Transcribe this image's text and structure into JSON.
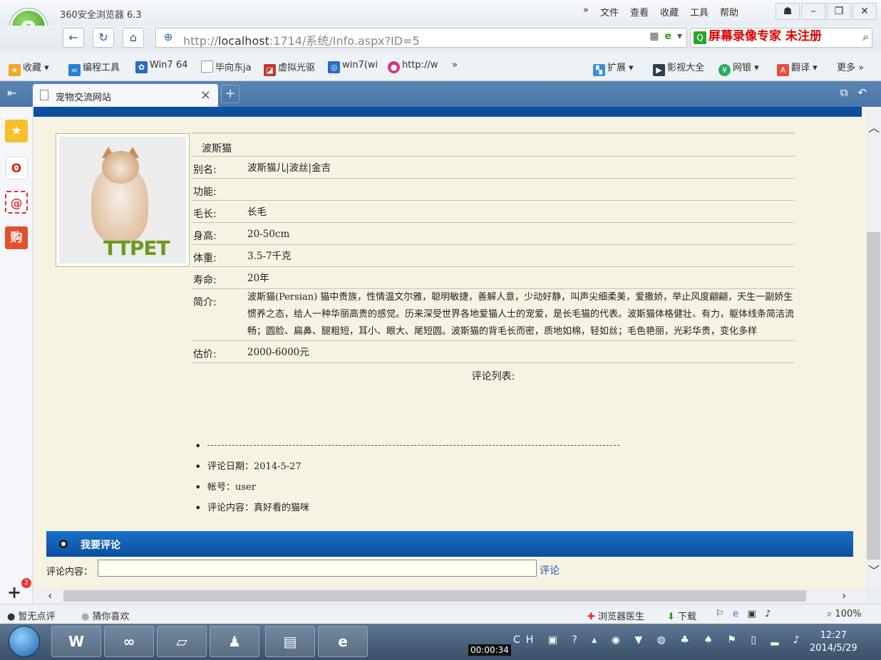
{
  "browser": {
    "app_title": "360安全浏览器 6.3",
    "menu": [
      "»",
      "文件",
      "查看",
      "收藏",
      "工具",
      "帮助"
    ],
    "url_prefix": "http://",
    "url_host": "localhost",
    "url_rest": ":1714/系统/Info.aspx?ID=5",
    "watermark": "屏幕录像专家 未注册",
    "bookmarks": [
      {
        "label": "收藏",
        "icon": "star-icon",
        "color": "#f5a623"
      },
      {
        "label": "编程工具",
        "icon": "code-icon",
        "color": "#2b7fd6"
      },
      {
        "label": "Win7 64",
        "icon": "paw-icon",
        "color": "#2b6cc2"
      },
      {
        "label": "毕向东ja",
        "icon": "page-icon",
        "color": "#9aa4ae"
      },
      {
        "label": "虚拟光驱",
        "icon": "disc-icon",
        "color": "#c0392b"
      },
      {
        "label": "win7(wi",
        "icon": "globe-icon",
        "color": "#2b6cc2"
      },
      {
        "label": "http://w",
        "icon": "candy-icon",
        "color": "#d63384"
      }
    ],
    "bookmarks_more": "»",
    "bookmarks_right": [
      {
        "label": "扩展",
        "icon": "puzzle-icon",
        "color": "#3c8dde"
      },
      {
        "label": "影视大全",
        "icon": "film-icon",
        "color": "#2c3e50"
      },
      {
        "label": "网银",
        "icon": "bank-icon",
        "color": "#27ae60"
      },
      {
        "label": "翻译",
        "icon": "translate-icon",
        "color": "#e74c3c"
      },
      {
        "label": "更多 »",
        "icon": "",
        "color": ""
      }
    ],
    "tab_title": "宠物交流网站",
    "status_left": [
      "暂无点评",
      "猜你喜欢"
    ],
    "status_right": [
      "浏览器医生",
      "下载"
    ],
    "zoom": "100%"
  },
  "pet": {
    "name": "波斯猫",
    "rows": [
      {
        "label": "别名:",
        "value": "波斯猫儿|波丝|金吉"
      },
      {
        "label": "功能:",
        "value": ""
      },
      {
        "label": "毛长:",
        "value": "长毛"
      },
      {
        "label": "身高:",
        "value": "20-50cm"
      },
      {
        "label": "体重:",
        "value": "3.5-7千克"
      },
      {
        "label": "寿命:",
        "value": "20年"
      },
      {
        "label": "简介:",
        "value": "波斯猫(Persian) 猫中贵族，性情温文尔雅，聪明敏捷，善解人意，少动好静，叫声尖细柔美，爱撒娇，举止风度翩翩，天生一副娇生惯养之态，给人一种华丽高贵的感觉。历来深受世界各地爱猫人士的宠爱，是长毛猫的代表。波斯猫体格健壮、有力，躯体线条简洁流畅；圆脸、扁鼻、腿粗短，耳小、眼大、尾短圆。波斯猫的背毛长而密，质地如棉，轻如丝；毛色艳丽，光彩华贵，变化多样"
      },
      {
        "label": "估价:",
        "value": "2000-6000元"
      }
    ],
    "logo_text": "TTPET"
  },
  "comments": {
    "heading": "评论列表:",
    "date": "评论日期：2014-5-27",
    "account": "帐号：user",
    "content": "评论内容：真好看的猫咪"
  },
  "my_comment": {
    "heading": "我要评论",
    "label": "评论内容：",
    "value": "",
    "submit": "评论"
  },
  "taskbar": {
    "timer": "00:00:34",
    "time": "12:27",
    "date": "2014/5/29"
  }
}
